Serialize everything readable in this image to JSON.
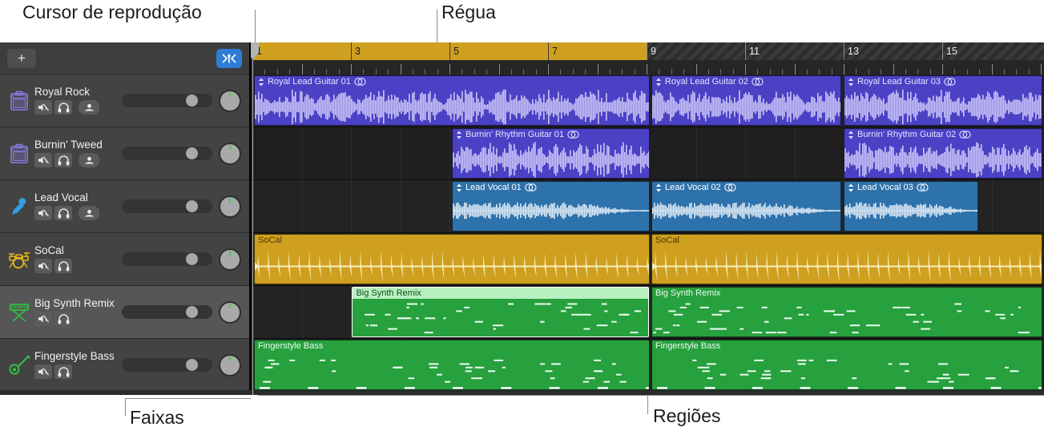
{
  "annotations": {
    "playhead": "Cursor de reprodução",
    "ruler": "Régua",
    "tracks": "Faixas",
    "regions": "Regiões"
  },
  "toolbar": {
    "add_label": "+",
    "add_name": "add-track-button",
    "flex_icon": "flex-icon"
  },
  "colors": {
    "cycle": "#cfa01f",
    "audio_guitar": "#4b41c4",
    "audio_vocal": "#2e72ab",
    "drummer": "#cfa01f",
    "midi": "#27a03e",
    "accent_blue": "#2f7cd6",
    "pan_indicator": "#3ad14f"
  },
  "ruler": {
    "bars": [
      "1",
      "3",
      "5",
      "7",
      "9",
      "11",
      "13",
      "15"
    ],
    "cycle_start_bar": "1",
    "cycle_end_bar": "9"
  },
  "tracks": [
    {
      "name": "Royal Rock",
      "icon": "guitar-amp-icon",
      "icon_color": "#8a7fe8",
      "selected": false,
      "has_record": true,
      "buttons": [
        "mute-button",
        "solo-button",
        "record-enable-button"
      ],
      "volume": 78,
      "pan": 0
    },
    {
      "name": "Burnin’ Tweed",
      "icon": "guitar-amp-icon",
      "icon_color": "#8a7fe8",
      "selected": false,
      "has_record": true,
      "buttons": [
        "mute-button",
        "solo-button",
        "record-enable-button"
      ],
      "volume": 78,
      "pan": 0
    },
    {
      "name": "Lead Vocal",
      "icon": "microphone-icon",
      "icon_color": "#2f9fe0",
      "selected": false,
      "has_record": true,
      "buttons": [
        "mute-button",
        "solo-button",
        "record-enable-button"
      ],
      "volume": 78,
      "pan": 0
    },
    {
      "name": "SoCal",
      "icon": "drum-kit-icon",
      "icon_color": "#e8b317",
      "selected": false,
      "has_record": false,
      "buttons": [
        "mute-button",
        "solo-button"
      ],
      "volume": 78,
      "pan": 0
    },
    {
      "name": "Big Synth Remix",
      "icon": "keyboard-icon",
      "icon_color": "#2fbf45",
      "selected": true,
      "has_record": false,
      "buttons": [
        "mute-button",
        "solo-button"
      ],
      "volume": 78,
      "pan": 0
    },
    {
      "name": "Fingerstyle Bass",
      "icon": "bass-guitar-icon",
      "icon_color": "#2fbf45",
      "selected": false,
      "has_record": false,
      "buttons": [
        "mute-button",
        "solo-button"
      ],
      "volume": 78,
      "pan": 0
    }
  ],
  "regions": [
    {
      "lane": 0,
      "name": "Royal Lead Guitar 01",
      "type": "audio-guitar",
      "start_pct": 0.4,
      "width_pct": 50.0,
      "transpose_icon": true,
      "loop_icon": true,
      "selected": false
    },
    {
      "lane": 0,
      "name": "Royal Lead Guitar 02",
      "type": "audio-guitar",
      "start_pct": 50.6,
      "width_pct": 24.0,
      "transpose_icon": true,
      "loop_icon": true,
      "selected": false
    },
    {
      "lane": 0,
      "name": "Royal Lead Guitar 03",
      "type": "audio-guitar",
      "start_pct": 74.9,
      "width_pct": 25.1,
      "transpose_icon": true,
      "loop_icon": true,
      "selected": false
    },
    {
      "lane": 1,
      "name": "Burnin’ Rhythm Guitar 01",
      "type": "audio-guitar",
      "start_pct": 25.4,
      "width_pct": 25.0,
      "transpose_icon": true,
      "loop_icon": true,
      "selected": false
    },
    {
      "lane": 1,
      "name": "Burnin’ Rhythm Guitar 02",
      "type": "audio-guitar",
      "start_pct": 74.9,
      "width_pct": 25.1,
      "transpose_icon": true,
      "loop_icon": true,
      "selected": false
    },
    {
      "lane": 2,
      "name": "Lead Vocal 01",
      "type": "audio-vocal",
      "start_pct": 25.4,
      "width_pct": 25.0,
      "transpose_icon": true,
      "loop_icon": true,
      "selected": false
    },
    {
      "lane": 2,
      "name": "Lead Vocal 02",
      "type": "audio-vocal",
      "start_pct": 50.6,
      "width_pct": 24.0,
      "transpose_icon": true,
      "loop_icon": true,
      "selected": false
    },
    {
      "lane": 2,
      "name": "Lead Vocal 03",
      "type": "audio-vocal",
      "start_pct": 74.9,
      "width_pct": 17.0,
      "transpose_icon": true,
      "loop_icon": true,
      "selected": false
    },
    {
      "lane": 3,
      "name": "SoCal",
      "type": "drummer",
      "start_pct": 0.4,
      "width_pct": 50.0,
      "transpose_icon": false,
      "loop_icon": false,
      "selected": false
    },
    {
      "lane": 3,
      "name": "SoCal",
      "type": "drummer",
      "start_pct": 50.6,
      "width_pct": 49.4,
      "transpose_icon": false,
      "loop_icon": false,
      "selected": false
    },
    {
      "lane": 4,
      "name": "Big Synth Remix",
      "type": "midi",
      "start_pct": 12.8,
      "width_pct": 37.5,
      "transpose_icon": false,
      "loop_icon": false,
      "selected": true
    },
    {
      "lane": 4,
      "name": "Big Synth Remix",
      "type": "midi",
      "start_pct": 50.6,
      "width_pct": 49.4,
      "transpose_icon": false,
      "loop_icon": false,
      "selected": false
    },
    {
      "lane": 5,
      "name": "Fingerstyle Bass",
      "type": "midi",
      "start_pct": 0.4,
      "width_pct": 50.0,
      "transpose_icon": false,
      "loop_icon": false,
      "selected": false
    },
    {
      "lane": 5,
      "name": "Fingerstyle Bass",
      "type": "midi",
      "start_pct": 50.6,
      "width_pct": 49.4,
      "transpose_icon": false,
      "loop_icon": false,
      "selected": false
    }
  ]
}
